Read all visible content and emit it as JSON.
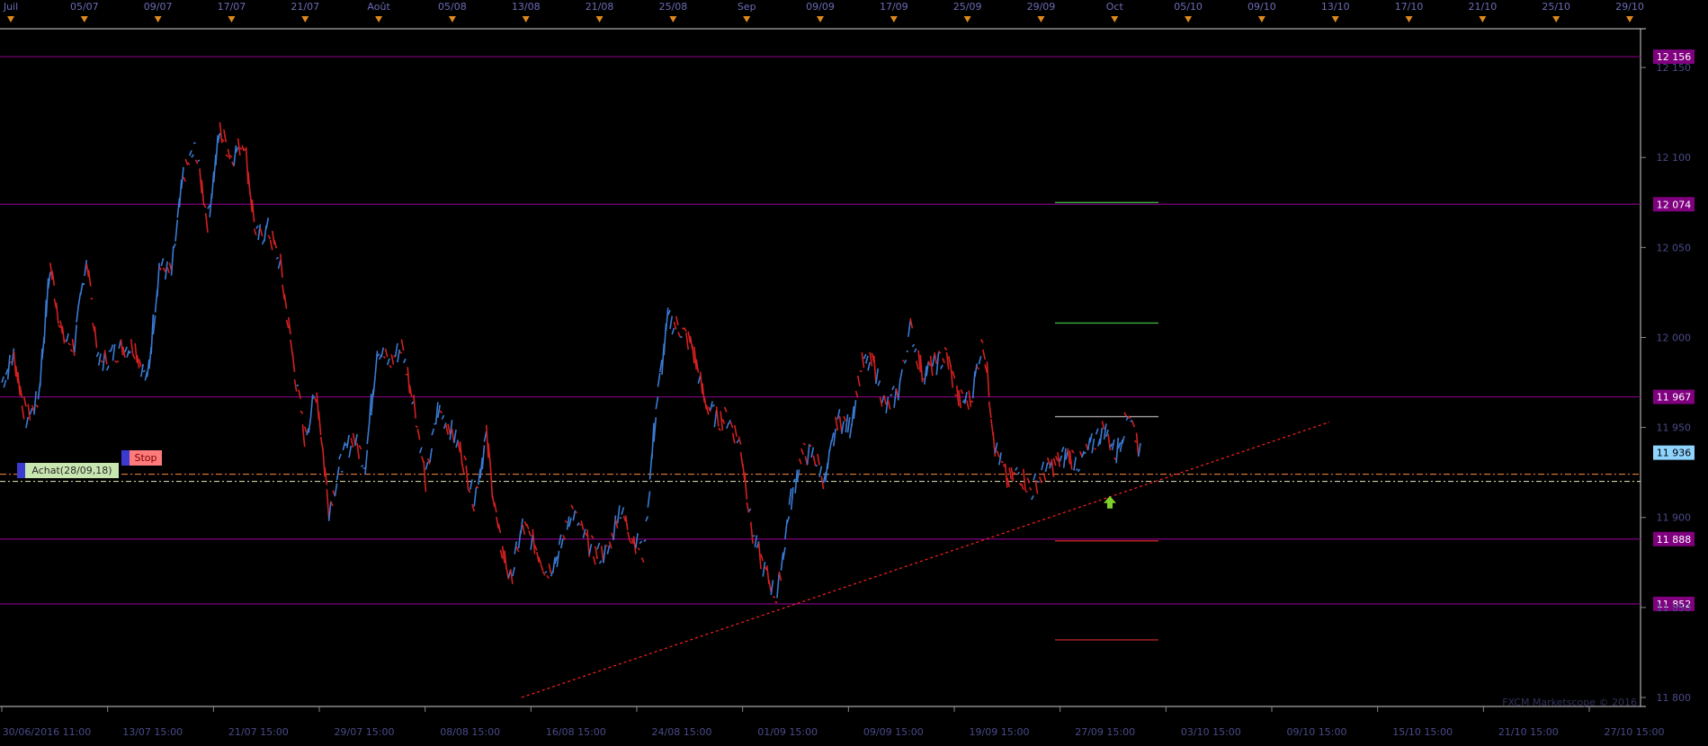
{
  "chart_data": {
    "type": "candlestick",
    "watermark": "FXCM Marketscope © 2016",
    "y_axis": {
      "ticks": [
        12150,
        12100,
        12050,
        12000,
        11950,
        11900,
        11850,
        11800
      ],
      "tick_labels": [
        "12 150",
        "12 100",
        "12 050",
        "12 000",
        "11 950",
        "11 900",
        "11 850",
        "11 800"
      ]
    },
    "x_axis": {
      "labels": [
        "30/06/2016 11:00",
        "13/07 15:00",
        "21/07 15:00",
        "29/07 15:00",
        "08/08 15:00",
        "16/08 15:00",
        "24/08 15:00",
        "01/09 15:00",
        "09/09 15:00",
        "19/09 15:00",
        "27/09 15:00",
        "03/10 15:00",
        "09/10 15:00",
        "15/10 15:00",
        "21/10 15:00",
        "27/10 15:00"
      ]
    },
    "top_dates": [
      "Juil",
      "05/07",
      "09/07",
      "17/07",
      "21/07",
      "Août",
      "05/08",
      "13/08",
      "21/08",
      "25/08",
      "Sep",
      "09/09",
      "17/09",
      "25/09",
      "29/09",
      "Oct",
      "05/10",
      "09/10",
      "13/10",
      "17/10",
      "21/10",
      "25/10",
      "29/10"
    ],
    "horizontal_levels": [
      {
        "value": 12156,
        "label": "12 156",
        "color": "#800080"
      },
      {
        "value": 12074,
        "label": "12 074",
        "color": "#800080"
      },
      {
        "value": 11967,
        "label": "11 967",
        "color": "#800080"
      },
      {
        "value": 11888,
        "label": "11 888",
        "color": "#800080"
      },
      {
        "value": 11852,
        "label": "11 852",
        "color": "#800080"
      }
    ],
    "current_price": {
      "value": 11936,
      "label": "11 936",
      "color": "#8fd3ff"
    },
    "targets": [
      {
        "value": 12075,
        "color": "#3cb043"
      },
      {
        "value": 12008,
        "color": "#3cb043"
      },
      {
        "value": 11956,
        "color": "#a0a0a0"
      },
      {
        "value": 11887,
        "color": "#b22222"
      },
      {
        "value": 11832,
        "color": "#b22222"
      }
    ],
    "entry_line": {
      "value": 11924,
      "color": "#ff8c42"
    },
    "stop_line": {
      "value": 11920,
      "color": "#e8e8c0"
    },
    "trendline": {
      "from": {
        "date": "16/08 15:00",
        "value": 11800
      },
      "to": {
        "date": "03/10 15:00",
        "value": 11953
      },
      "color": "#ff2020"
    },
    "orders": [
      {
        "label": "Achat(28/09,18)",
        "type": "entry"
      },
      {
        "label": "Stop",
        "type": "stop"
      }
    ],
    "signal": {
      "date": "29/09",
      "value": 11908,
      "direction": "up"
    },
    "series": [
      {
        "date": "30/06/2016 11:00",
        "value": 11975
      },
      {
        "value": 11990
      },
      {
        "value": 11955
      },
      {
        "value": 11965
      },
      {
        "value": 12040
      },
      {
        "value": 12000
      },
      {
        "value": 11995
      },
      {
        "value": 12045
      },
      {
        "value": 11985
      },
      {
        "value": 11990
      },
      {
        "date": "13/07 15:00",
        "value": 11995
      },
      {
        "value": 11995
      },
      {
        "value": 11975
      },
      {
        "value": 12040
      },
      {
        "value": 12035
      },
      {
        "value": 12090
      },
      {
        "value": 12105
      },
      {
        "value": 12065
      },
      {
        "value": 12115
      },
      {
        "value": 12100
      },
      {
        "date": "21/07 15:00",
        "value": 12110
      },
      {
        "value": 12055
      },
      {
        "value": 12060
      },
      {
        "value": 12040
      },
      {
        "value": 11990
      },
      {
        "value": 11945
      },
      {
        "value": 11970
      },
      {
        "value": 11905
      },
      {
        "value": 11930
      },
      {
        "value": 11945
      },
      {
        "date": "29/07 15:00",
        "value": 11930
      },
      {
        "value": 11995
      },
      {
        "value": 11985
      },
      {
        "value": 11995
      },
      {
        "value": 11965
      },
      {
        "value": 11920
      },
      {
        "value": 11960
      },
      {
        "value": 11950
      },
      {
        "value": 11935
      },
      {
        "value": 11910
      },
      {
        "date": "08/08 15:00",
        "value": 11945
      },
      {
        "value": 11890
      },
      {
        "value": 11865
      },
      {
        "value": 11895
      },
      {
        "value": 11885
      },
      {
        "value": 11870
      },
      {
        "value": 11880
      },
      {
        "value": 11905
      },
      {
        "value": 11890
      },
      {
        "value": 11880
      },
      {
        "date": "16/08 15:00",
        "value": 11880
      },
      {
        "value": 11905
      },
      {
        "value": 11890
      },
      {
        "value": 11880
      },
      {
        "value": 11960
      },
      {
        "value": 12010
      },
      {
        "value": 12005
      },
      {
        "value": 11995
      },
      {
        "value": 11965
      },
      {
        "value": 11955
      },
      {
        "date": "01/09 15:00",
        "value": 11955
      },
      {
        "value": 11940
      },
      {
        "value": 11890
      },
      {
        "value": 11870
      },
      {
        "value": 11855
      },
      {
        "value": 11905
      },
      {
        "value": 11935
      },
      {
        "value": 11935
      },
      {
        "value": 11920
      },
      {
        "value": 11955
      },
      {
        "date": "09/09 15:00",
        "value": 11950
      },
      {
        "value": 11985
      },
      {
        "value": 11985
      },
      {
        "value": 11960
      },
      {
        "value": 11970
      },
      {
        "value": 12005
      },
      {
        "value": 11980
      },
      {
        "value": 11985
      },
      {
        "value": 11990
      },
      {
        "value": 11965
      },
      {
        "date": "19/09 15:00",
        "value": 11965
      },
      {
        "value": 12000
      },
      {
        "value": 11940
      },
      {
        "value": 11920
      },
      {
        "value": 11925
      },
      {
        "value": 11915
      },
      {
        "value": 11925
      },
      {
        "value": 11930
      },
      {
        "value": 11935
      },
      {
        "value": 11930
      },
      {
        "date": "27/09 15:00",
        "value": 11940
      },
      {
        "value": 11950
      },
      {
        "value": 11935
      },
      {
        "value": 11960
      },
      {
        "value": 11936
      }
    ]
  }
}
